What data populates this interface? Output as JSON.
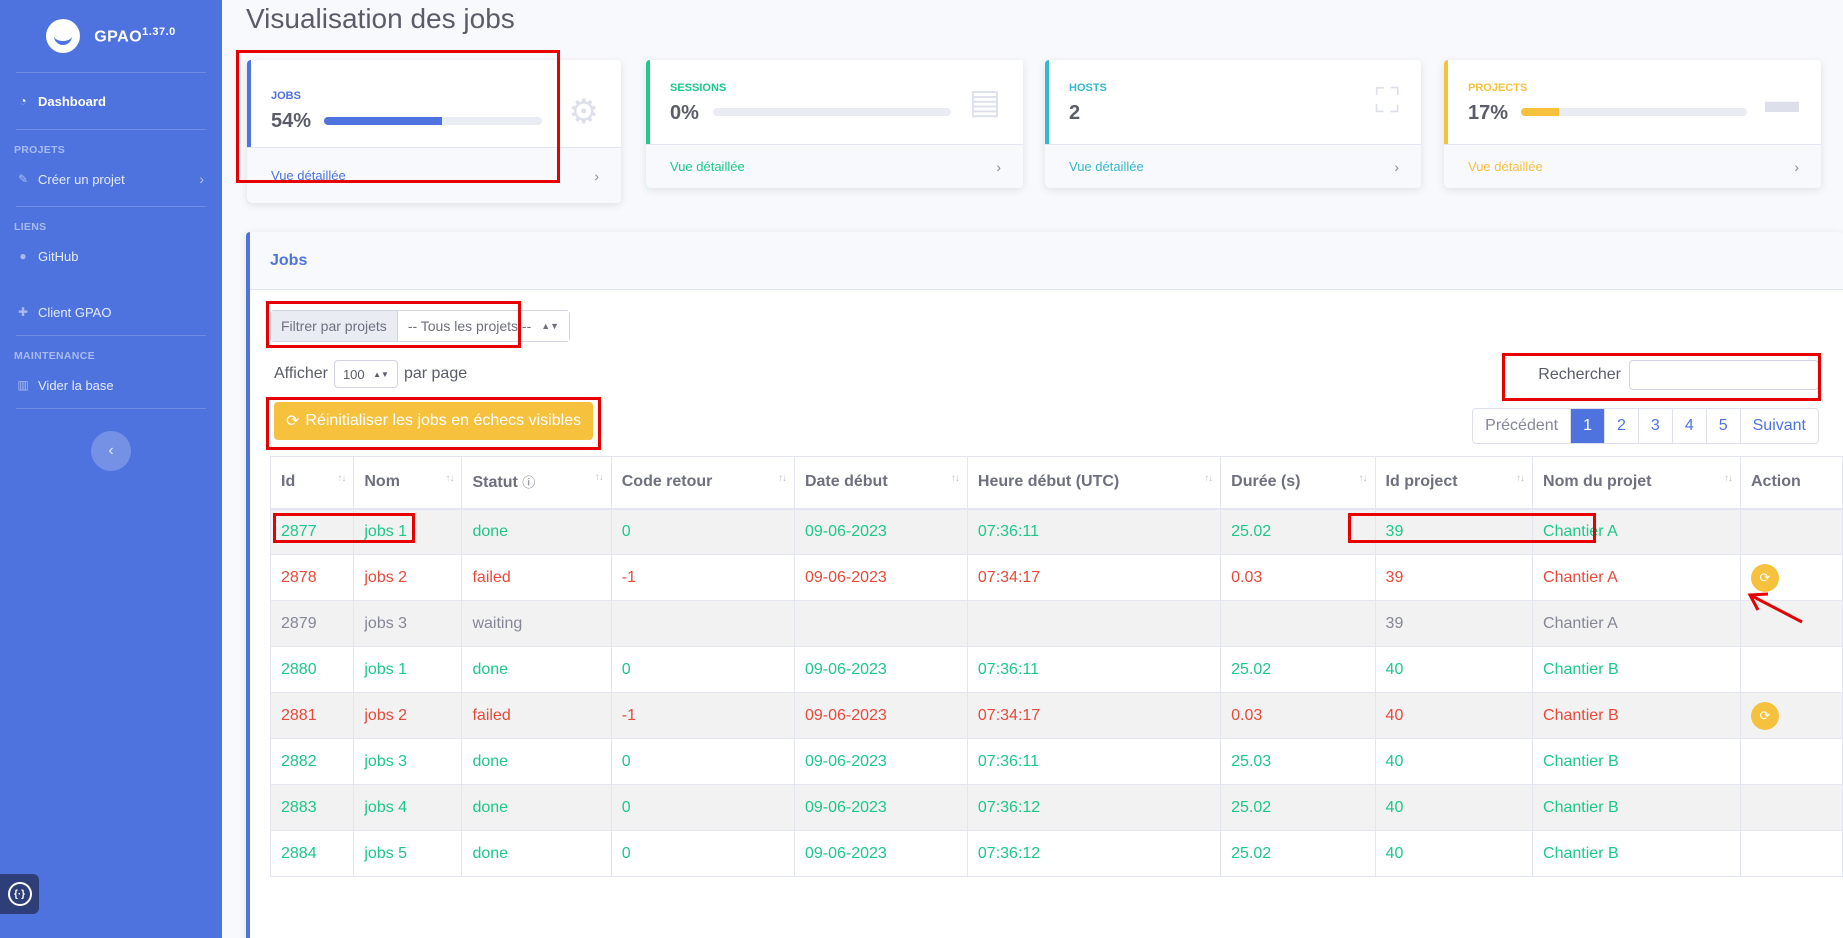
{
  "sidebar": {
    "brand": "GPAO",
    "version": "1.37.0",
    "dashboard": "Dashboard",
    "heading_projects": "PROJETS",
    "create_project": "Créer un projet",
    "heading_links": "LIENS",
    "github": "GitHub",
    "client": "Client GPAO",
    "heading_maintenance": "MAINTENANCE",
    "clear_db": "Vider la base"
  },
  "page": {
    "title": "Visualisation des jobs"
  },
  "cards": {
    "jobs": {
      "label": "JOBS",
      "value": "54%",
      "progress": 0.54,
      "link": "Vue détaillée",
      "color": "#4e73df"
    },
    "sessions": {
      "label": "SESSIONS",
      "value": "0%",
      "progress": 0,
      "link": "Vue détaillée",
      "color": "#1cc88a"
    },
    "hosts": {
      "label": "HOSTS",
      "value": "2",
      "link": "Vue détaillée",
      "color": "#36b9cc"
    },
    "projects": {
      "label": "PROJECTS",
      "value": "17%",
      "progress": 0.17,
      "link": "Vue détaillée",
      "color": "#f6c23e"
    }
  },
  "jobs_panel": {
    "title": "Jobs",
    "filter_label": "Filtrer par projets",
    "filter_value": "-- Tous les projets --",
    "show_label": "Afficher",
    "show_value": "100",
    "per_page": "par page",
    "search_label": "Rechercher",
    "reset_button": "Réinitialiser les jobs en échecs visibles",
    "pager": {
      "prev": "Précédent",
      "pages": [
        "1",
        "2",
        "3",
        "4",
        "5"
      ],
      "next": "Suivant",
      "current": "1"
    },
    "columns": [
      "Id",
      "Nom",
      "Statut",
      "Code retour",
      "Date début",
      "Heure début (UTC)",
      "Durée (s)",
      "Id project",
      "Nom du projet",
      "Action"
    ],
    "rows": [
      [
        "2877",
        "jobs 1",
        "done",
        "0",
        "09-06-2023",
        "07:36:11",
        "25.02",
        "39",
        "Chantier A"
      ],
      [
        "2878",
        "jobs 2",
        "failed",
        "-1",
        "09-06-2023",
        "07:34:17",
        "0.03",
        "39",
        "Chantier A"
      ],
      [
        "2879",
        "jobs 3",
        "waiting",
        "",
        "",
        "",
        "",
        "39",
        "Chantier A"
      ],
      [
        "2880",
        "jobs 1",
        "done",
        "0",
        "09-06-2023",
        "07:36:11",
        "25.02",
        "40",
        "Chantier B"
      ],
      [
        "2881",
        "jobs 2",
        "failed",
        "-1",
        "09-06-2023",
        "07:34:17",
        "0.03",
        "40",
        "Chantier B"
      ],
      [
        "2882",
        "jobs 3",
        "done",
        "0",
        "09-06-2023",
        "07:36:11",
        "25.03",
        "40",
        "Chantier B"
      ],
      [
        "2883",
        "jobs 4",
        "done",
        "0",
        "09-06-2023",
        "07:36:12",
        "25.02",
        "40",
        "Chantier B"
      ],
      [
        "2884",
        "jobs 5",
        "done",
        "0",
        "09-06-2023",
        "07:36:12",
        "25.02",
        "40",
        "Chantier B"
      ]
    ]
  },
  "icons": {
    "dashboard": "gauge-icon",
    "create_project": "wrench-icon",
    "github": "github-icon",
    "client": "puzzle-icon",
    "clear_db": "trash-icon",
    "jobs_card": "gears-icon",
    "sessions_card": "chip-icon",
    "hosts_card": "sitemap-icon",
    "projects_card": "folder-icon",
    "retry": "refresh-icon"
  }
}
